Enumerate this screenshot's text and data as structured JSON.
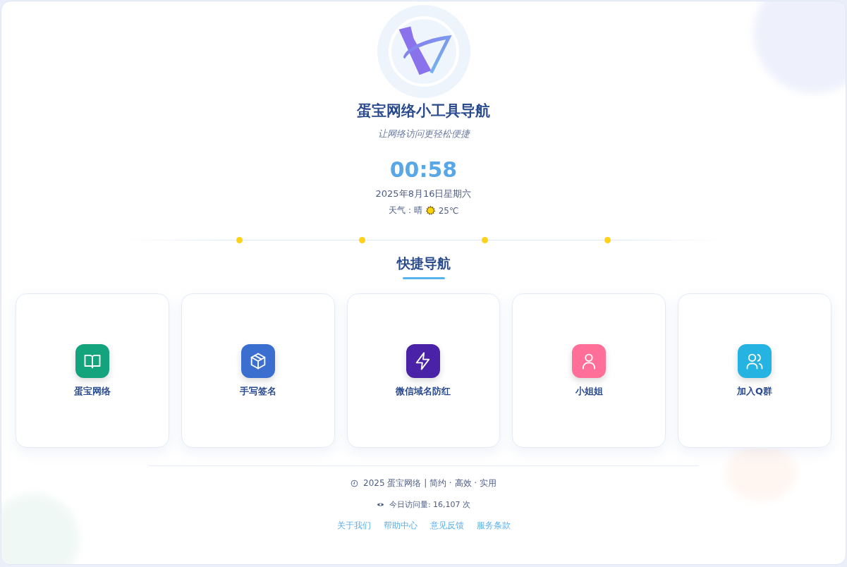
{
  "header": {
    "title": "蛋宝网络小工具导航",
    "subtitle": "让网络访问更轻松便捷"
  },
  "clock": {
    "time": "00:58",
    "date": "2025年8月16日星期六",
    "weather_label": "天气：晴",
    "temperature": "25℃"
  },
  "section": {
    "title": "快捷导航"
  },
  "cards": [
    {
      "label": "蛋宝网络",
      "kind": "book",
      "color": "#13a37d"
    },
    {
      "label": "手写签名",
      "kind": "box",
      "color": "#3a6fd0"
    },
    {
      "label": "微信域名防红",
      "kind": "bolt",
      "color": "#4a22a8"
    },
    {
      "label": "小姐姐",
      "kind": "user",
      "color": "#ff6f98"
    },
    {
      "label": "加入Q群",
      "kind": "users",
      "color": "#25b3e2"
    }
  ],
  "footer": {
    "copyright": "2025 蛋宝网络 | 简约 · 高效 · 实用",
    "visits": "今日访问量: 16,107 次",
    "links": [
      "关于我们",
      "帮助中心",
      "意见反馈",
      "服务条款"
    ]
  }
}
